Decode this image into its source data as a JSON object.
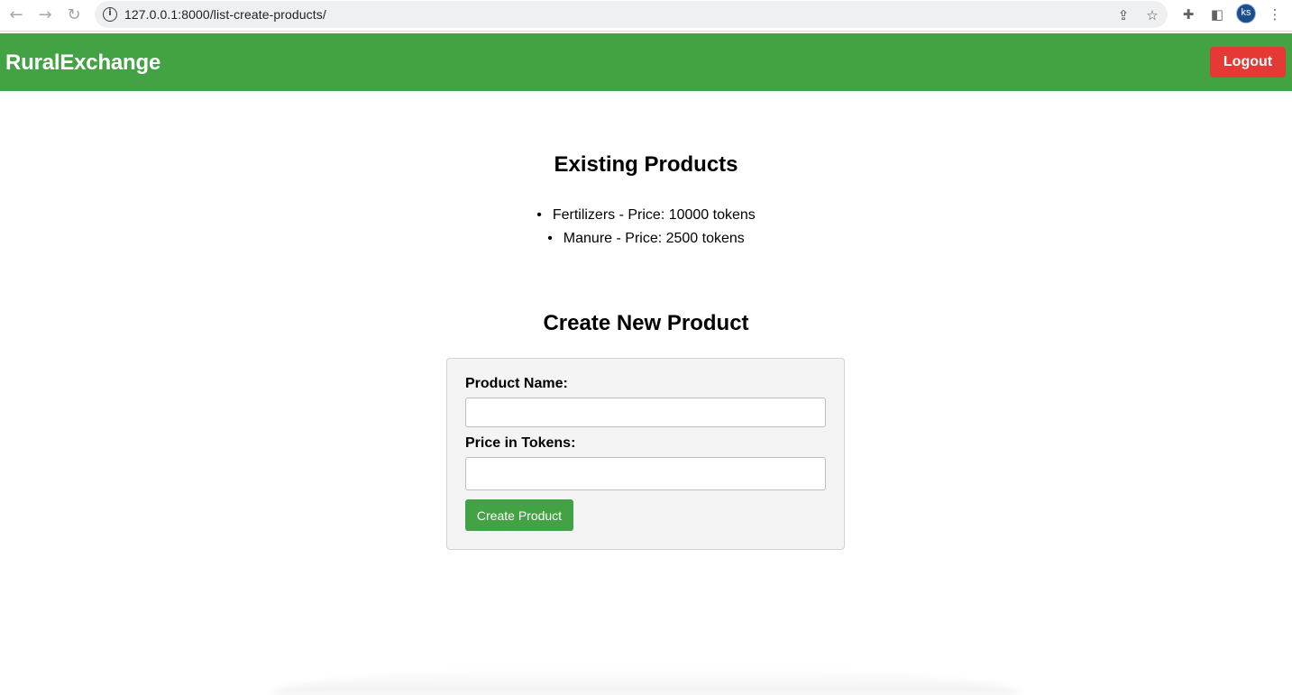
{
  "browser": {
    "url": "127.0.0.1:8000/list-create-products/",
    "profile_initials": "ks",
    "icons": [
      "back-arrow-icon",
      "forward-arrow-icon",
      "reload-icon",
      "site-info-icon",
      "share-icon",
      "bookmark-star-icon",
      "extensions-puzzle-icon",
      "side-panel-icon",
      "kebab-menu-icon"
    ]
  },
  "header": {
    "brand": "RuralExchange",
    "logout_label": "Logout",
    "color": "#43a243",
    "logout_color": "#e43935"
  },
  "existing": {
    "title": "Existing Products",
    "products": [
      {
        "text": "Fertilizers - Price: 10000 tokens"
      },
      {
        "text": "Manure - Price: 2500 tokens"
      }
    ]
  },
  "create": {
    "title": "Create New Product",
    "name_label": "Product Name:",
    "name_value": "",
    "price_label": "Price in Tokens:",
    "price_value": "",
    "submit_label": "Create Product"
  }
}
